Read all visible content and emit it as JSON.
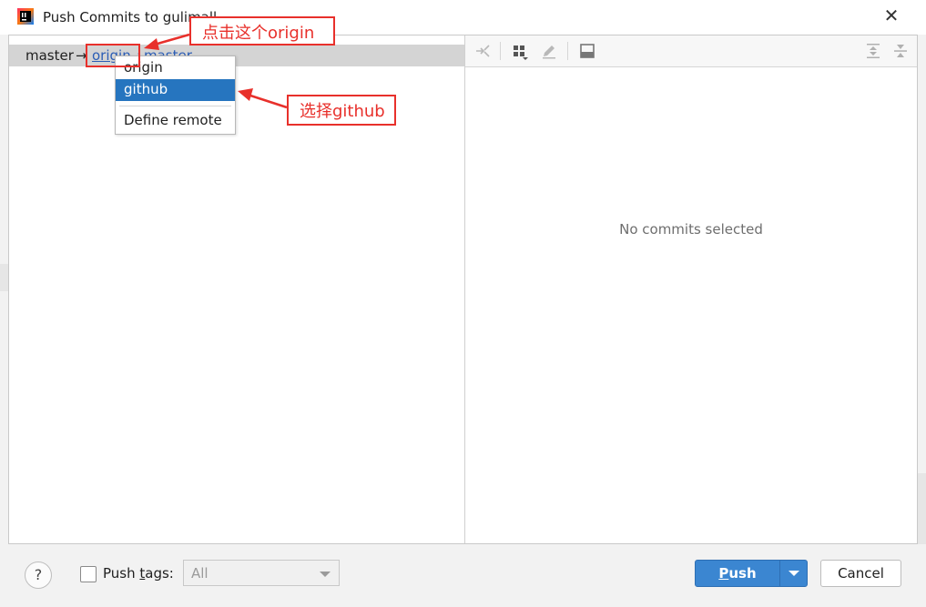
{
  "window": {
    "title": "Push Commits to gulimall",
    "close_glyph": "✕"
  },
  "branch_row": {
    "local_branch": "master",
    "arrow": "→",
    "remote": "origin",
    "separator": ":",
    "remote_branch": "master"
  },
  "remote_popup": {
    "items": [
      "origin",
      "github",
      "Define remote"
    ],
    "selected": "github"
  },
  "right_pane": {
    "empty_text": "No commits selected",
    "toolbar_icons": [
      "pin-icon",
      "group-icon",
      "edit-icon",
      "preview-icon",
      "expand-all-icon",
      "collapse-all-icon"
    ]
  },
  "footer": {
    "help_glyph": "?",
    "push_tags_label_pre": "Push ",
    "push_tags_label_mnemonic": "t",
    "push_tags_label_post": "ags:",
    "tags_select_value": "All",
    "push_button_mnemonic": "P",
    "push_button_rest": "ush",
    "cancel_button": "Cancel"
  },
  "annotations": {
    "click_origin": "点击这个origin",
    "choose_github": "选择github"
  },
  "colors": {
    "accent_blue": "#3b86d1",
    "selection_blue": "#2675bf",
    "annotation_red": "#e8302b",
    "link_blue": "#2b5db5"
  }
}
